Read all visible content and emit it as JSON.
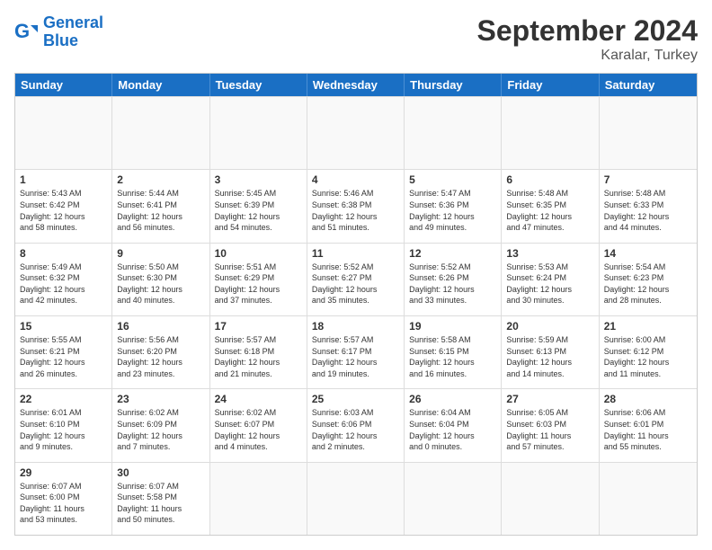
{
  "header": {
    "logo_line1": "General",
    "logo_line2": "Blue",
    "month": "September 2024",
    "location": "Karalar, Turkey"
  },
  "weekdays": [
    "Sunday",
    "Monday",
    "Tuesday",
    "Wednesday",
    "Thursday",
    "Friday",
    "Saturday"
  ],
  "rows": [
    [
      {
        "day": "",
        "info": ""
      },
      {
        "day": "",
        "info": ""
      },
      {
        "day": "",
        "info": ""
      },
      {
        "day": "",
        "info": ""
      },
      {
        "day": "",
        "info": ""
      },
      {
        "day": "",
        "info": ""
      },
      {
        "day": "",
        "info": ""
      }
    ],
    [
      {
        "day": "1",
        "info": "Sunrise: 5:43 AM\nSunset: 6:42 PM\nDaylight: 12 hours\nand 58 minutes."
      },
      {
        "day": "2",
        "info": "Sunrise: 5:44 AM\nSunset: 6:41 PM\nDaylight: 12 hours\nand 56 minutes."
      },
      {
        "day": "3",
        "info": "Sunrise: 5:45 AM\nSunset: 6:39 PM\nDaylight: 12 hours\nand 54 minutes."
      },
      {
        "day": "4",
        "info": "Sunrise: 5:46 AM\nSunset: 6:38 PM\nDaylight: 12 hours\nand 51 minutes."
      },
      {
        "day": "5",
        "info": "Sunrise: 5:47 AM\nSunset: 6:36 PM\nDaylight: 12 hours\nand 49 minutes."
      },
      {
        "day": "6",
        "info": "Sunrise: 5:48 AM\nSunset: 6:35 PM\nDaylight: 12 hours\nand 47 minutes."
      },
      {
        "day": "7",
        "info": "Sunrise: 5:48 AM\nSunset: 6:33 PM\nDaylight: 12 hours\nand 44 minutes."
      }
    ],
    [
      {
        "day": "8",
        "info": "Sunrise: 5:49 AM\nSunset: 6:32 PM\nDaylight: 12 hours\nand 42 minutes."
      },
      {
        "day": "9",
        "info": "Sunrise: 5:50 AM\nSunset: 6:30 PM\nDaylight: 12 hours\nand 40 minutes."
      },
      {
        "day": "10",
        "info": "Sunrise: 5:51 AM\nSunset: 6:29 PM\nDaylight: 12 hours\nand 37 minutes."
      },
      {
        "day": "11",
        "info": "Sunrise: 5:52 AM\nSunset: 6:27 PM\nDaylight: 12 hours\nand 35 minutes."
      },
      {
        "day": "12",
        "info": "Sunrise: 5:52 AM\nSunset: 6:26 PM\nDaylight: 12 hours\nand 33 minutes."
      },
      {
        "day": "13",
        "info": "Sunrise: 5:53 AM\nSunset: 6:24 PM\nDaylight: 12 hours\nand 30 minutes."
      },
      {
        "day": "14",
        "info": "Sunrise: 5:54 AM\nSunset: 6:23 PM\nDaylight: 12 hours\nand 28 minutes."
      }
    ],
    [
      {
        "day": "15",
        "info": "Sunrise: 5:55 AM\nSunset: 6:21 PM\nDaylight: 12 hours\nand 26 minutes."
      },
      {
        "day": "16",
        "info": "Sunrise: 5:56 AM\nSunset: 6:20 PM\nDaylight: 12 hours\nand 23 minutes."
      },
      {
        "day": "17",
        "info": "Sunrise: 5:57 AM\nSunset: 6:18 PM\nDaylight: 12 hours\nand 21 minutes."
      },
      {
        "day": "18",
        "info": "Sunrise: 5:57 AM\nSunset: 6:17 PM\nDaylight: 12 hours\nand 19 minutes."
      },
      {
        "day": "19",
        "info": "Sunrise: 5:58 AM\nSunset: 6:15 PM\nDaylight: 12 hours\nand 16 minutes."
      },
      {
        "day": "20",
        "info": "Sunrise: 5:59 AM\nSunset: 6:13 PM\nDaylight: 12 hours\nand 14 minutes."
      },
      {
        "day": "21",
        "info": "Sunrise: 6:00 AM\nSunset: 6:12 PM\nDaylight: 12 hours\nand 11 minutes."
      }
    ],
    [
      {
        "day": "22",
        "info": "Sunrise: 6:01 AM\nSunset: 6:10 PM\nDaylight: 12 hours\nand 9 minutes."
      },
      {
        "day": "23",
        "info": "Sunrise: 6:02 AM\nSunset: 6:09 PM\nDaylight: 12 hours\nand 7 minutes."
      },
      {
        "day": "24",
        "info": "Sunrise: 6:02 AM\nSunset: 6:07 PM\nDaylight: 12 hours\nand 4 minutes."
      },
      {
        "day": "25",
        "info": "Sunrise: 6:03 AM\nSunset: 6:06 PM\nDaylight: 12 hours\nand 2 minutes."
      },
      {
        "day": "26",
        "info": "Sunrise: 6:04 AM\nSunset: 6:04 PM\nDaylight: 12 hours\nand 0 minutes."
      },
      {
        "day": "27",
        "info": "Sunrise: 6:05 AM\nSunset: 6:03 PM\nDaylight: 11 hours\nand 57 minutes."
      },
      {
        "day": "28",
        "info": "Sunrise: 6:06 AM\nSunset: 6:01 PM\nDaylight: 11 hours\nand 55 minutes."
      }
    ],
    [
      {
        "day": "29",
        "info": "Sunrise: 6:07 AM\nSunset: 6:00 PM\nDaylight: 11 hours\nand 53 minutes."
      },
      {
        "day": "30",
        "info": "Sunrise: 6:07 AM\nSunset: 5:58 PM\nDaylight: 11 hours\nand 50 minutes."
      },
      {
        "day": "",
        "info": ""
      },
      {
        "day": "",
        "info": ""
      },
      {
        "day": "",
        "info": ""
      },
      {
        "day": "",
        "info": ""
      },
      {
        "day": "",
        "info": ""
      }
    ]
  ]
}
